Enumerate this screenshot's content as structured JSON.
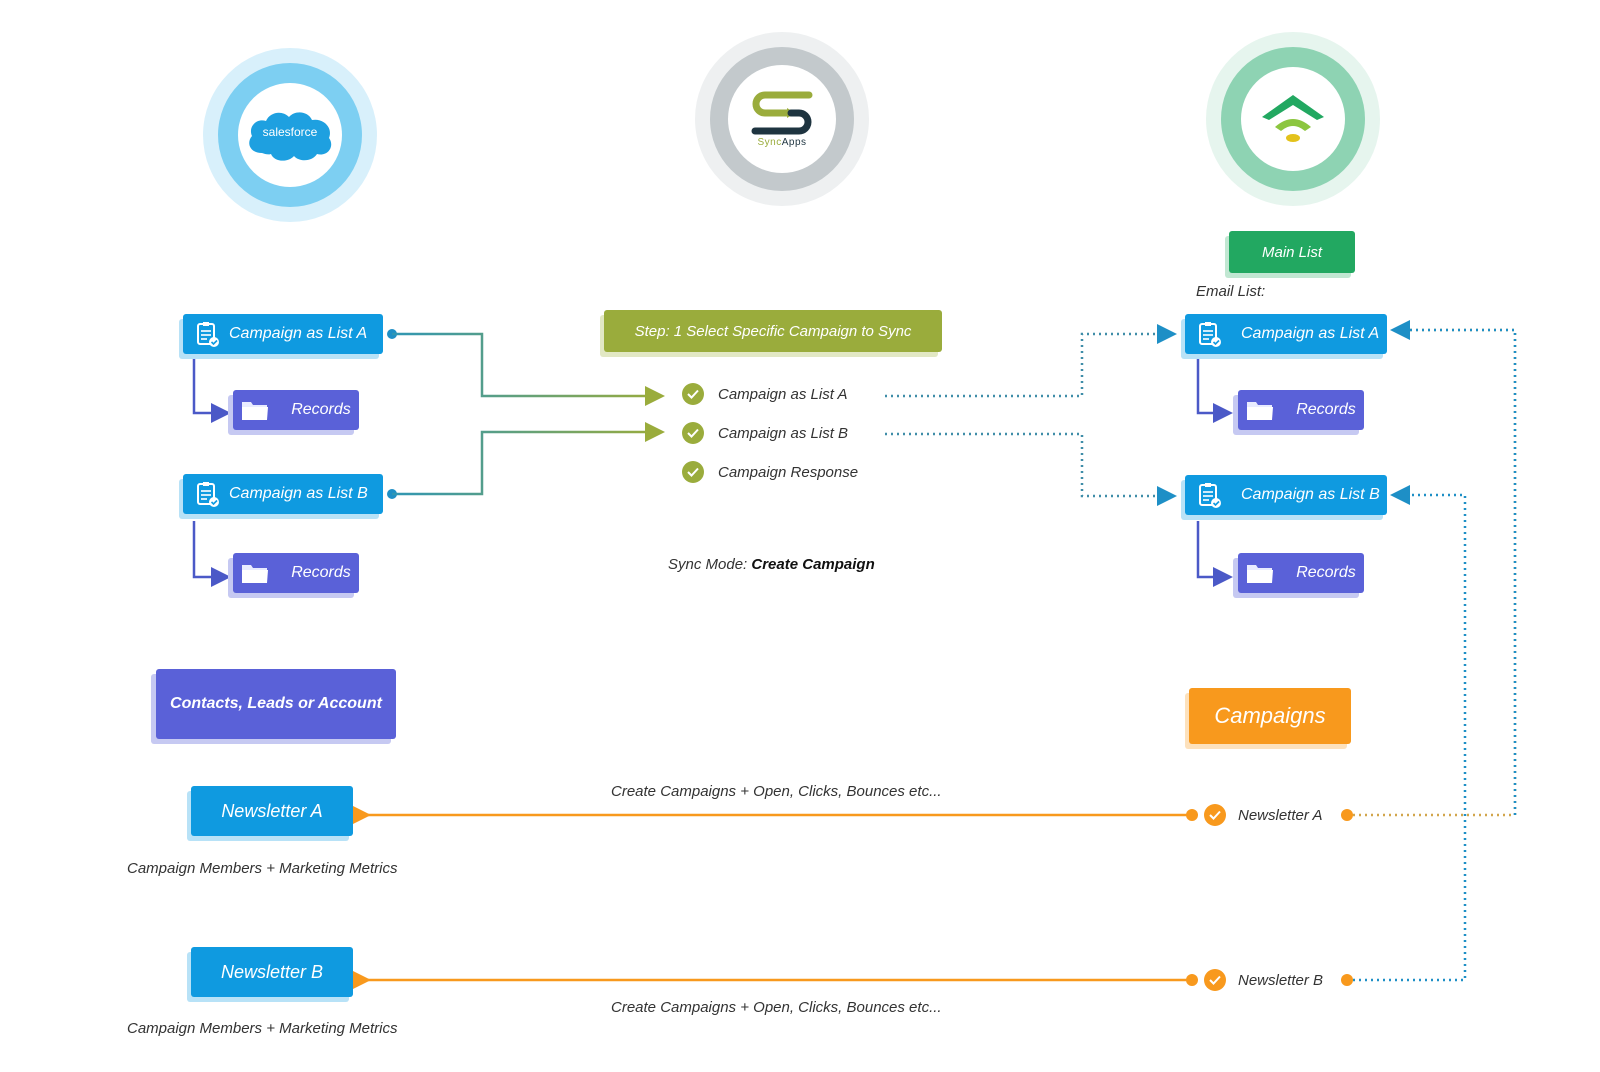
{
  "logos": {
    "salesforce": {
      "label": "salesforce",
      "ring_outer": "#d8f0fb",
      "ring_mid": "#7dcff2",
      "cloud": "#1ea0e0"
    },
    "syncapps": {
      "label_a": "Sync",
      "label_b": "Apps",
      "ring_outer": "#eef0f1",
      "ring_mid": "#c3c9cc"
    },
    "mailchimp_like": {
      "ring_outer": "#e6f5ee",
      "ring_mid": "#8ed3b3"
    }
  },
  "left": {
    "list_a": "Campaign as List A",
    "records_a": "Records",
    "list_b": "Campaign as List B",
    "records_b": "Records",
    "contacts": "Contacts, Leads or Account",
    "newsletter_a": "Newsletter A",
    "newsletter_a_caption": "Campaign Members + Marketing Metrics",
    "newsletter_b": "Newsletter B",
    "newsletter_b_caption": "Campaign Members + Marketing Metrics"
  },
  "middle": {
    "step_label": "Step: 1 Select Specific Campaign to Sync",
    "options": [
      {
        "label": "Campaign as List A",
        "checked": true
      },
      {
        "label": "Campaign as List B",
        "checked": true
      },
      {
        "label": "Campaign Response",
        "checked": true
      }
    ],
    "sync_mode_label": "Sync Mode:",
    "sync_mode_value": "Create Campaign",
    "flow_top_caption": "Create Campaigns + Open, Clicks, Bounces etc...",
    "flow_bottom_caption": "Create Campaigns + Open, Clicks, Bounces etc..."
  },
  "right": {
    "main_list": "Main List",
    "email_list_label": "Email List:",
    "list_a": "Campaign as List A",
    "records_a": "Records",
    "list_b": "Campaign as List B",
    "records_b": "Records",
    "campaigns": "Campaigns",
    "newsletter_a": "Newsletter A",
    "newsletter_b": "Newsletter B"
  },
  "colors": {
    "blue": "#0f9ae0",
    "purple": "#5a61d8",
    "green": "#22a861",
    "olive": "#9aac3c",
    "orange": "#f8991d",
    "teal_line": "#2f96b4",
    "dotted_blue": "#1e8fc6",
    "dotted_olive": "#9aac3c"
  }
}
